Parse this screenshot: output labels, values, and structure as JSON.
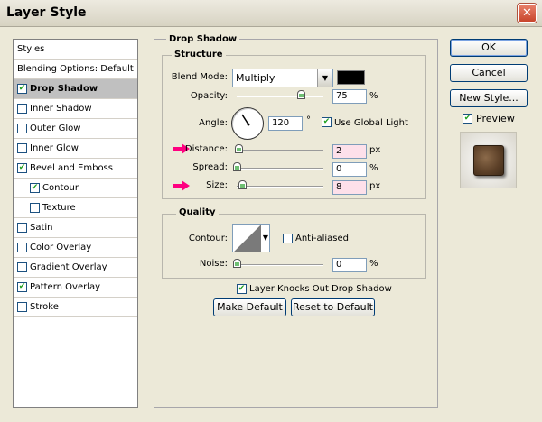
{
  "window": {
    "title": "Layer Style",
    "close_glyph": "✕"
  },
  "styles_panel": {
    "header": "Styles",
    "items": [
      {
        "label": "Blending Options: Default"
      },
      {
        "label": "Drop Shadow",
        "checked": true,
        "selected": true
      },
      {
        "label": "Inner Shadow",
        "checked": false
      },
      {
        "label": "Outer Glow",
        "checked": false
      },
      {
        "label": "Inner Glow",
        "checked": false
      },
      {
        "label": "Bevel and Emboss",
        "checked": true
      },
      {
        "label": "Contour",
        "checked": true
      },
      {
        "label": "Texture",
        "checked": false
      },
      {
        "label": "Satin",
        "checked": false
      },
      {
        "label": "Color Overlay",
        "checked": false
      },
      {
        "label": "Gradient Overlay",
        "checked": false
      },
      {
        "label": "Pattern Overlay",
        "checked": true
      },
      {
        "label": "Stroke",
        "checked": false
      }
    ]
  },
  "drop_shadow": {
    "title": "Drop Shadow",
    "structure": {
      "legend": "Structure",
      "blend_mode_label": "Blend Mode:",
      "blend_mode_value": "Multiply",
      "shadow_color": "#000000",
      "opacity_label": "Opacity:",
      "opacity_value": "75",
      "opacity_unit": "%",
      "opacity_level": 0.75,
      "angle_label": "Angle:",
      "angle_value": "120",
      "angle_unit": "°",
      "use_global_light_label": "Use Global Light",
      "use_global_light_checked": true,
      "distance_label": "Distance:",
      "distance_value": "2",
      "distance_unit": "px",
      "spread_label": "Spread:",
      "spread_value": "0",
      "spread_unit": "%",
      "size_label": "Size:",
      "size_value": "8",
      "size_unit": "px"
    },
    "quality": {
      "legend": "Quality",
      "contour_label": "Contour:",
      "anti_aliased_label": "Anti-aliased",
      "anti_aliased_checked": false,
      "noise_label": "Noise:",
      "noise_value": "0",
      "noise_unit": "%"
    },
    "knockout_label": "Layer Knocks Out Drop Shadow",
    "knockout_checked": true,
    "make_default_label": "Make Default",
    "reset_default_label": "Reset to Default"
  },
  "buttons": {
    "ok_label": "OK",
    "cancel_label": "Cancel",
    "new_style_label": "New Style...",
    "preview_label": "Preview",
    "preview_checked": true
  },
  "colors": {
    "highlight_arrow": "#ff0080",
    "check_mark": "#21a121"
  }
}
